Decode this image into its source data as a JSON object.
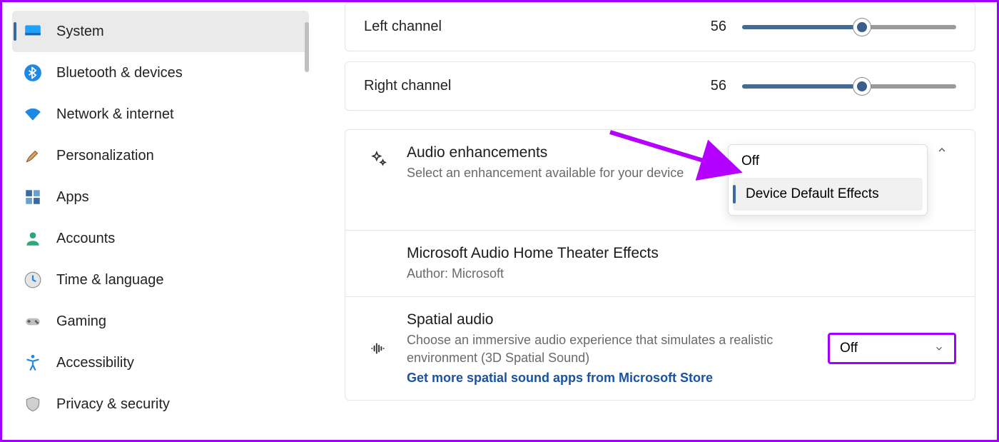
{
  "sidebar": {
    "items": [
      {
        "label": "System",
        "name": "sidebar-item-system",
        "icon": "monitor",
        "active": true
      },
      {
        "label": "Bluetooth & devices",
        "name": "sidebar-item-bluetooth",
        "icon": "bluetooth",
        "active": false
      },
      {
        "label": "Network & internet",
        "name": "sidebar-item-network",
        "icon": "wifi",
        "active": false
      },
      {
        "label": "Personalization",
        "name": "sidebar-item-personalization",
        "icon": "brush",
        "active": false
      },
      {
        "label": "Apps",
        "name": "sidebar-item-apps",
        "icon": "apps",
        "active": false
      },
      {
        "label": "Accounts",
        "name": "sidebar-item-accounts",
        "icon": "person",
        "active": false
      },
      {
        "label": "Time & language",
        "name": "sidebar-item-time",
        "icon": "clock",
        "active": false
      },
      {
        "label": "Gaming",
        "name": "sidebar-item-gaming",
        "icon": "gamepad",
        "active": false
      },
      {
        "label": "Accessibility",
        "name": "sidebar-item-accessibility",
        "icon": "accessibility",
        "active": false
      },
      {
        "label": "Privacy & security",
        "name": "sidebar-item-privacy",
        "icon": "shield",
        "active": false
      }
    ]
  },
  "channels": {
    "left": {
      "label": "Left channel",
      "value": "56",
      "percent": 56
    },
    "right": {
      "label": "Right channel",
      "value": "56",
      "percent": 56
    }
  },
  "enhancements": {
    "title": "Audio enhancements",
    "sub": "Select an enhancement available for your device",
    "dropdown": {
      "opt1": "Off",
      "opt2": "Device Default Effects"
    }
  },
  "hometheater": {
    "title": "Microsoft Audio Home Theater Effects",
    "author": "Author: Microsoft"
  },
  "spatial": {
    "title": "Spatial audio",
    "sub": "Choose an immersive audio experience that simulates a realistic environment (3D Spatial Sound)",
    "link": "Get more spatial sound apps from Microsoft Store",
    "select_value": "Off"
  },
  "colors": {
    "accent": "#3b6aa0",
    "highlight": "#9f00ff"
  }
}
